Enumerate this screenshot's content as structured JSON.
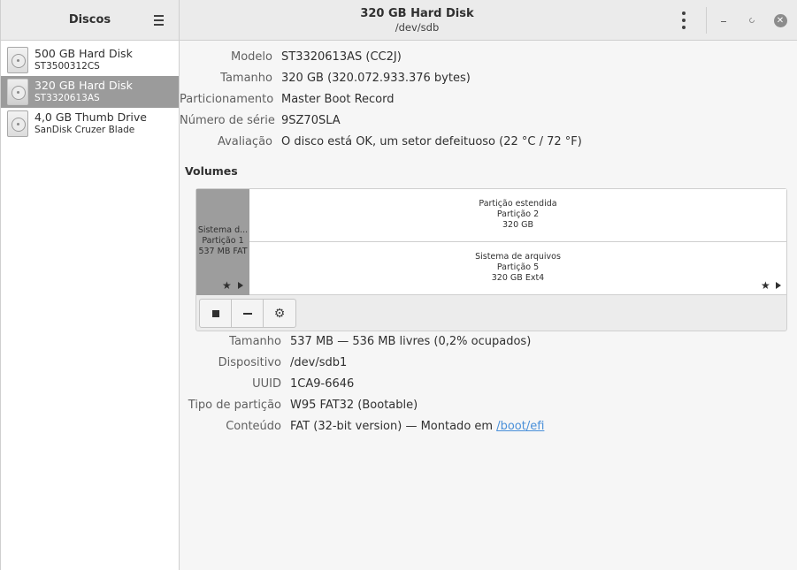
{
  "sidebar": {
    "title": "Discos",
    "disks": [
      {
        "name": "500 GB Hard Disk",
        "model": "ST3500312CS",
        "selected": false
      },
      {
        "name": "320 GB Hard Disk",
        "model": "ST3320613AS",
        "selected": true
      },
      {
        "name": "4,0 GB Thumb Drive",
        "model": "SanDisk Cruzer Blade",
        "selected": false
      }
    ]
  },
  "header": {
    "title": "320 GB Hard Disk",
    "subtitle": "/dev/sdb",
    "close_glyph": "✕"
  },
  "drive": {
    "model_label": "Modelo",
    "model_value": "ST3320613AS (CC2J)",
    "size_label": "Tamanho",
    "size_value": "320 GB (320.072.933.376 bytes)",
    "partitioning_label": "Particionamento",
    "partitioning_value": "Master Boot Record",
    "serial_label": "Número de série",
    "serial_value": "9SZ70SLA",
    "assessment_label": "Avaliação",
    "assessment_value": "O disco está OK, um setor defeituoso (22 °C / 72 °F)"
  },
  "volumes": {
    "title": "Volumes",
    "partitions": [
      {
        "line1": "Sistema d...",
        "line2": "Partição 1",
        "line3": "537 MB FAT"
      },
      {
        "line1": "Partição estendida",
        "line2": "Partição 2",
        "line3": "320 GB"
      },
      {
        "line1": "Sistema de arquivos",
        "line2": "Partição 5",
        "line3": "320 GB Ext4"
      }
    ],
    "toolbar_icons": [
      "stop-icon",
      "minus-icon",
      "gear-icon"
    ]
  },
  "selected_volume": {
    "size_label": "Tamanho",
    "size_value": "537 MB — 536 MB livres (0,2% ocupados)",
    "device_label": "Dispositivo",
    "device_value": "/dev/sdb1",
    "uuid_label": "UUID",
    "uuid_value": "1CA9-6646",
    "parttype_label": "Tipo de partição",
    "parttype_value": "W95 FAT32 (Bootable)",
    "contents_label": "Conteúdo",
    "contents_value": "FAT (32-bit version) — Montado em",
    "mount_link": "/boot/efi"
  },
  "colors": {
    "selected_row": "#9b9b9b",
    "link": "#4a90d9",
    "header_bg": "#ebebeb"
  }
}
